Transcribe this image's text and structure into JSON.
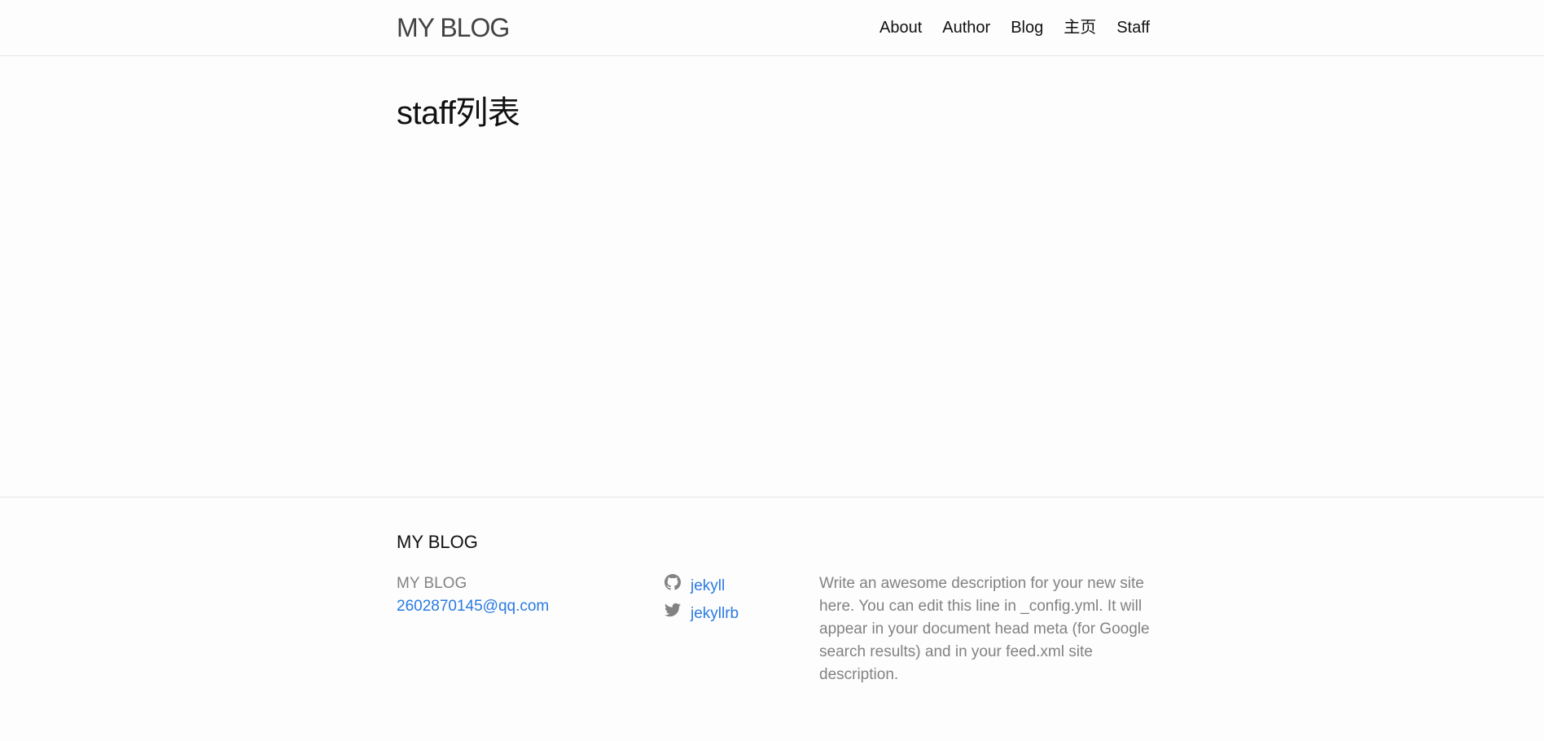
{
  "header": {
    "site_title": "MY BLOG",
    "nav": [
      {
        "label": "About"
      },
      {
        "label": "Author"
      },
      {
        "label": "Blog"
      },
      {
        "label": "主页"
      },
      {
        "label": "Staff"
      }
    ]
  },
  "main": {
    "page_heading": "staff列表"
  },
  "footer": {
    "heading": "MY BLOG",
    "site_name": "MY BLOG",
    "email": "2602870145@qq.com",
    "social": [
      {
        "icon": "github-icon",
        "label": "jekyll"
      },
      {
        "icon": "twitter-icon",
        "label": "jekyllrb"
      }
    ],
    "description": "Write an awesome description for your new site here. You can edit this line in _config.yml. It will appear in your document head meta (for Google search results) and in your feed.xml site description."
  },
  "colors": {
    "link": "#2a7ae2",
    "muted_text": "#828282",
    "border": "#e8e8e8",
    "background": "#fdfdfd"
  }
}
